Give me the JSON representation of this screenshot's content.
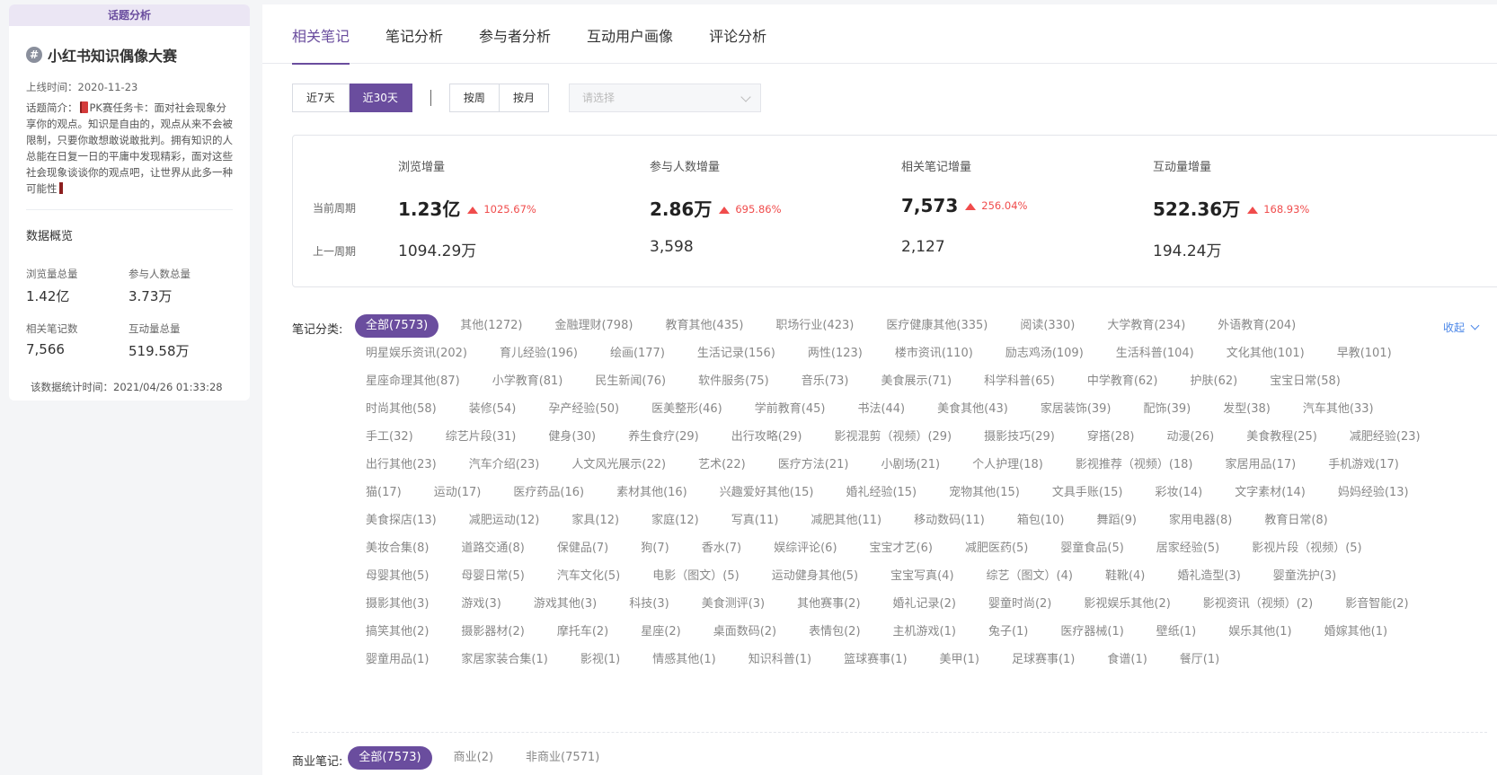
{
  "left": {
    "header": "话题分析",
    "title": "小红书知识偶像大赛",
    "online_time": "上线时间：2020-11-23",
    "intro_prefix": "话题简介：",
    "intro_text": "PK赛任务卡：面对社会现象分享你的观点。知识是自由的，观点从来不会被限制，只要你敢想敢说敢批判。拥有知识的人总能在日复一日的平庸中发现精彩，面对这些社会现象谈谈你的观点吧，让世界从此多一种可能性",
    "overview_title": "数据概览",
    "stats": [
      {
        "label": "浏览量总量",
        "value": "1.42亿"
      },
      {
        "label": "参与人数总量",
        "value": "3.73万"
      },
      {
        "label": "相关笔记数",
        "value": "7,566"
      },
      {
        "label": "互动量总量",
        "value": "519.58万"
      }
    ],
    "stat_time": "该数据统计时间：2021/04/26 01:33:28"
  },
  "tabs": [
    {
      "label": "相关笔记",
      "active": true
    },
    {
      "label": "笔记分析",
      "active": false
    },
    {
      "label": "参与者分析",
      "active": false
    },
    {
      "label": "互动用户画像",
      "active": false
    },
    {
      "label": "评论分析",
      "active": false
    }
  ],
  "filters": {
    "range_buttons": [
      {
        "label": "近7天",
        "active": false
      },
      {
        "label": "近30天",
        "active": true
      }
    ],
    "period_buttons": [
      {
        "label": "按周",
        "active": false
      },
      {
        "label": "按月",
        "active": false
      }
    ],
    "select_placeholder": "请选择"
  },
  "summary": {
    "row_current": "当前周期",
    "row_previous": "上一周期",
    "columns": [
      {
        "header": "浏览增量",
        "current": "1.23亿",
        "growth": "1025.67%",
        "previous": "1094.29万"
      },
      {
        "header": "参与人数增量",
        "current": "2.86万",
        "growth": "695.86%",
        "previous": "3,598"
      },
      {
        "header": "相关笔记增量",
        "current": "7,573",
        "growth": "256.04%",
        "previous": "2,127"
      },
      {
        "header": "互动量增量",
        "current": "522.36万",
        "growth": "168.93%",
        "previous": "194.24万"
      }
    ]
  },
  "categories": {
    "label": "笔记分类:",
    "collapse_label": "收起",
    "items": [
      "全部(7573)",
      "其他(1272)",
      "金融理财(798)",
      "教育其他(435)",
      "职场行业(423)",
      "医疗健康其他(335)",
      "阅读(330)",
      "大学教育(234)",
      "外语教育(204)",
      "明星娱乐资讯(202)",
      "育儿经验(196)",
      "绘画(177)",
      "生活记录(156)",
      "两性(123)",
      "楼市资讯(110)",
      "励志鸡汤(109)",
      "生活科普(104)",
      "文化其他(101)",
      "早教(101)",
      "星座命理其他(87)",
      "小学教育(81)",
      "民生新闻(76)",
      "软件服务(75)",
      "音乐(73)",
      "美食展示(71)",
      "科学科普(65)",
      "中学教育(62)",
      "护肤(62)",
      "宝宝日常(58)",
      "时尚其他(58)",
      "装修(54)",
      "孕产经验(50)",
      "医美整形(46)",
      "学前教育(45)",
      "书法(44)",
      "美食其他(43)",
      "家居装饰(39)",
      "配饰(39)",
      "发型(38)",
      "汽车其他(33)",
      "手工(32)",
      "综艺片段(31)",
      "健身(30)",
      "养生食疗(29)",
      "出行攻略(29)",
      "影视混剪（视频）(29)",
      "摄影技巧(29)",
      "穿搭(28)",
      "动漫(26)",
      "美食教程(25)",
      "减肥经验(23)",
      "出行其他(23)",
      "汽车介绍(23)",
      "人文风光展示(22)",
      "艺术(22)",
      "医疗方法(21)",
      "小剧场(21)",
      "个人护理(18)",
      "影视推荐（视频）(18)",
      "家居用品(17)",
      "手机游戏(17)",
      "猫(17)",
      "运动(17)",
      "医疗药品(16)",
      "素材其他(16)",
      "兴趣爱好其他(15)",
      "婚礼经验(15)",
      "宠物其他(15)",
      "文具手账(15)",
      "彩妆(14)",
      "文字素材(14)",
      "妈妈经验(13)",
      "美食探店(13)",
      "减肥运动(12)",
      "家具(12)",
      "家庭(12)",
      "写真(11)",
      "减肥其他(11)",
      "移动数码(11)",
      "箱包(10)",
      "舞蹈(9)",
      "家用电器(8)",
      "教育日常(8)",
      "美妆合集(8)",
      "道路交通(8)",
      "保健品(7)",
      "狗(7)",
      "香水(7)",
      "娱综评论(6)",
      "宝宝才艺(6)",
      "减肥医药(5)",
      "婴童食品(5)",
      "居家经验(5)",
      "影视片段（视频）(5)",
      "母婴其他(5)",
      "母婴日常(5)",
      "汽车文化(5)",
      "电影（图文）(5)",
      "运动健身其他(5)",
      "宝宝写真(4)",
      "综艺（图文）(4)",
      "鞋靴(4)",
      "婚礼造型(3)",
      "婴童洗护(3)",
      "摄影其他(3)",
      "游戏(3)",
      "游戏其他(3)",
      "科技(3)",
      "美食测评(3)",
      "其他赛事(2)",
      "婚礼记录(2)",
      "婴童时尚(2)",
      "影视娱乐其他(2)",
      "影视资讯（视频）(2)",
      "影音智能(2)",
      "搞笑其他(2)",
      "摄影器材(2)",
      "摩托车(2)",
      "星座(2)",
      "桌面数码(2)",
      "表情包(2)",
      "主机游戏(1)",
      "兔子(1)",
      "医疗器械(1)",
      "壁纸(1)",
      "娱乐其他(1)",
      "婚嫁其他(1)",
      "婴童用品(1)",
      "家居家装合集(1)",
      "影视(1)",
      "情感其他(1)",
      "知识科普(1)",
      "篮球赛事(1)",
      "美甲(1)",
      "足球赛事(1)",
      "食谱(1)",
      "餐厅(1)"
    ]
  },
  "business": {
    "label": "商业笔记:",
    "items": [
      "全部(7573)",
      "商业(2)",
      "非商业(7571)"
    ]
  }
}
